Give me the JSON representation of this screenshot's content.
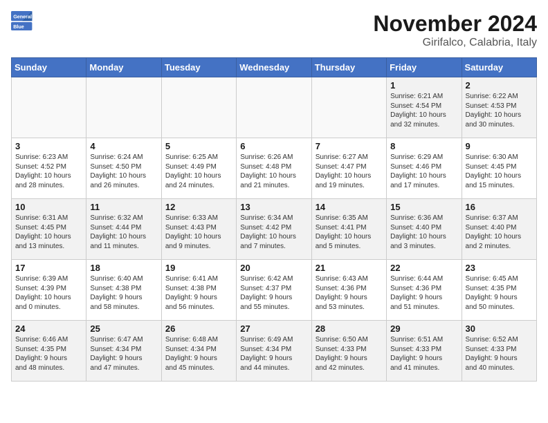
{
  "header": {
    "logo_line1": "General",
    "logo_line2": "Blue",
    "month": "November 2024",
    "location": "Girifalco, Calabria, Italy"
  },
  "weekdays": [
    "Sunday",
    "Monday",
    "Tuesday",
    "Wednesday",
    "Thursday",
    "Friday",
    "Saturday"
  ],
  "weeks": [
    [
      {
        "day": "",
        "info": ""
      },
      {
        "day": "",
        "info": ""
      },
      {
        "day": "",
        "info": ""
      },
      {
        "day": "",
        "info": ""
      },
      {
        "day": "",
        "info": ""
      },
      {
        "day": "1",
        "info": "Sunrise: 6:21 AM\nSunset: 4:54 PM\nDaylight: 10 hours\nand 32 minutes."
      },
      {
        "day": "2",
        "info": "Sunrise: 6:22 AM\nSunset: 4:53 PM\nDaylight: 10 hours\nand 30 minutes."
      }
    ],
    [
      {
        "day": "3",
        "info": "Sunrise: 6:23 AM\nSunset: 4:52 PM\nDaylight: 10 hours\nand 28 minutes."
      },
      {
        "day": "4",
        "info": "Sunrise: 6:24 AM\nSunset: 4:50 PM\nDaylight: 10 hours\nand 26 minutes."
      },
      {
        "day": "5",
        "info": "Sunrise: 6:25 AM\nSunset: 4:49 PM\nDaylight: 10 hours\nand 24 minutes."
      },
      {
        "day": "6",
        "info": "Sunrise: 6:26 AM\nSunset: 4:48 PM\nDaylight: 10 hours\nand 21 minutes."
      },
      {
        "day": "7",
        "info": "Sunrise: 6:27 AM\nSunset: 4:47 PM\nDaylight: 10 hours\nand 19 minutes."
      },
      {
        "day": "8",
        "info": "Sunrise: 6:29 AM\nSunset: 4:46 PM\nDaylight: 10 hours\nand 17 minutes."
      },
      {
        "day": "9",
        "info": "Sunrise: 6:30 AM\nSunset: 4:45 PM\nDaylight: 10 hours\nand 15 minutes."
      }
    ],
    [
      {
        "day": "10",
        "info": "Sunrise: 6:31 AM\nSunset: 4:45 PM\nDaylight: 10 hours\nand 13 minutes."
      },
      {
        "day": "11",
        "info": "Sunrise: 6:32 AM\nSunset: 4:44 PM\nDaylight: 10 hours\nand 11 minutes."
      },
      {
        "day": "12",
        "info": "Sunrise: 6:33 AM\nSunset: 4:43 PM\nDaylight: 10 hours\nand 9 minutes."
      },
      {
        "day": "13",
        "info": "Sunrise: 6:34 AM\nSunset: 4:42 PM\nDaylight: 10 hours\nand 7 minutes."
      },
      {
        "day": "14",
        "info": "Sunrise: 6:35 AM\nSunset: 4:41 PM\nDaylight: 10 hours\nand 5 minutes."
      },
      {
        "day": "15",
        "info": "Sunrise: 6:36 AM\nSunset: 4:40 PM\nDaylight: 10 hours\nand 3 minutes."
      },
      {
        "day": "16",
        "info": "Sunrise: 6:37 AM\nSunset: 4:40 PM\nDaylight: 10 hours\nand 2 minutes."
      }
    ],
    [
      {
        "day": "17",
        "info": "Sunrise: 6:39 AM\nSunset: 4:39 PM\nDaylight: 10 hours\nand 0 minutes."
      },
      {
        "day": "18",
        "info": "Sunrise: 6:40 AM\nSunset: 4:38 PM\nDaylight: 9 hours\nand 58 minutes."
      },
      {
        "day": "19",
        "info": "Sunrise: 6:41 AM\nSunset: 4:38 PM\nDaylight: 9 hours\nand 56 minutes."
      },
      {
        "day": "20",
        "info": "Sunrise: 6:42 AM\nSunset: 4:37 PM\nDaylight: 9 hours\nand 55 minutes."
      },
      {
        "day": "21",
        "info": "Sunrise: 6:43 AM\nSunset: 4:36 PM\nDaylight: 9 hours\nand 53 minutes."
      },
      {
        "day": "22",
        "info": "Sunrise: 6:44 AM\nSunset: 4:36 PM\nDaylight: 9 hours\nand 51 minutes."
      },
      {
        "day": "23",
        "info": "Sunrise: 6:45 AM\nSunset: 4:35 PM\nDaylight: 9 hours\nand 50 minutes."
      }
    ],
    [
      {
        "day": "24",
        "info": "Sunrise: 6:46 AM\nSunset: 4:35 PM\nDaylight: 9 hours\nand 48 minutes."
      },
      {
        "day": "25",
        "info": "Sunrise: 6:47 AM\nSunset: 4:34 PM\nDaylight: 9 hours\nand 47 minutes."
      },
      {
        "day": "26",
        "info": "Sunrise: 6:48 AM\nSunset: 4:34 PM\nDaylight: 9 hours\nand 45 minutes."
      },
      {
        "day": "27",
        "info": "Sunrise: 6:49 AM\nSunset: 4:34 PM\nDaylight: 9 hours\nand 44 minutes."
      },
      {
        "day": "28",
        "info": "Sunrise: 6:50 AM\nSunset: 4:33 PM\nDaylight: 9 hours\nand 42 minutes."
      },
      {
        "day": "29",
        "info": "Sunrise: 6:51 AM\nSunset: 4:33 PM\nDaylight: 9 hours\nand 41 minutes."
      },
      {
        "day": "30",
        "info": "Sunrise: 6:52 AM\nSunset: 4:33 PM\nDaylight: 9 hours\nand 40 minutes."
      }
    ]
  ]
}
